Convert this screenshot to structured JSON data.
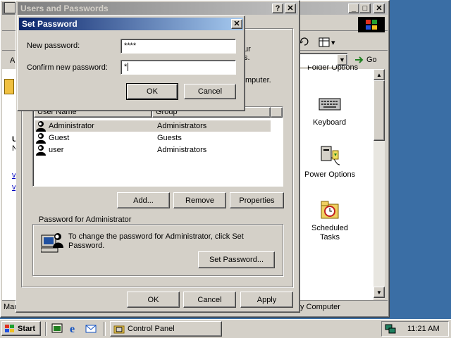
{
  "control_panel": {
    "title_min": "_",
    "title_max": "□",
    "title_close": "✕",
    "address_letter": "A",
    "go_label": "Go",
    "view_arrow": "▾",
    "side_letters": [
      "U",
      "N",
      "v",
      "v"
    ],
    "items": [
      {
        "label": "Keyboard"
      },
      {
        "label": "Power Options"
      },
      {
        "label": "Scheduled Tasks"
      }
    ],
    "partial_folder_options": "Folder Options",
    "status_left": "Mar",
    "status_right": "y Computer",
    "scroll_up": "▲",
    "scroll_down": "▼"
  },
  "users_dialog": {
    "title": "Users and Passwords",
    "help": "?",
    "close": "✕",
    "partial_text_1": "ur",
    "partial_text_2": "s.",
    "partial_text_3": "mputer.",
    "columns": [
      "User Name",
      "Group"
    ],
    "users": [
      {
        "name": "Administrator",
        "group": "Administrators"
      },
      {
        "name": "Guest",
        "group": "Guests"
      },
      {
        "name": "user",
        "group": "Administrators"
      }
    ],
    "add_button": "Add...",
    "remove_button": "Remove",
    "properties_button": "Properties",
    "password_group_label": "Password for Administrator",
    "password_text": "To change the password for Administrator, click Set Password.",
    "set_password_button": "Set Password...",
    "ok": "OK",
    "cancel": "Cancel",
    "apply": "Apply"
  },
  "set_password": {
    "title": "Set Password",
    "close": "✕",
    "new_password_label": "New password:",
    "new_password_value": "****",
    "confirm_label": "Confirm new password:",
    "confirm_value": "*",
    "ok": "OK",
    "cancel": "Cancel"
  },
  "taskbar": {
    "start": "Start",
    "task": "Control Panel",
    "clock": "11:21 AM"
  }
}
